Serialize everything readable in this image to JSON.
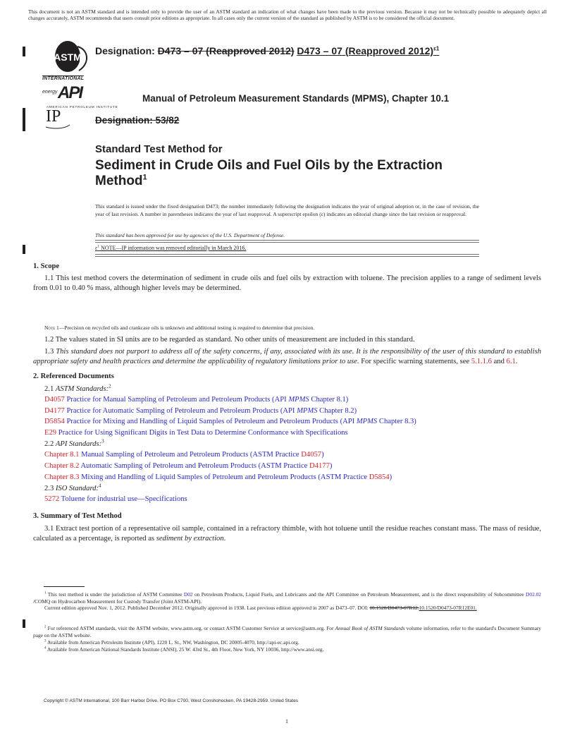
{
  "disclaimer": "This document is not an ASTM standard and is intended only to provide the user of an ASTM standard an indication of what changes have been made to the previous version. Because it may not be technically possible to adequately depict all changes accurately, ASTM recommends that users consult prior editions as appropriate. In all cases only the current version of the standard as published by ASTM is to be considered the official document.",
  "logos": {
    "astm_label": "INTERNATIONAL",
    "api_energy": "energy",
    "api_mark": "API",
    "api_label": "AMERICAN PETROLEUM INSTITUTE",
    "ip_mark": "IP"
  },
  "header": {
    "designation_label": "Designation: ",
    "designation_old": "D473 – 07 (Reapproved 2012)",
    "designation_new": "D473 – 07 (Reapproved 2012)",
    "designation_sup": "ε1",
    "mpms": "Manual of Petroleum Measurement Standards (MPMS), Chapter 10.1",
    "ip_designation_old": "Designation: 53/82"
  },
  "title": {
    "line1": "Standard Test Method for",
    "line2": "Sediment in Crude Oils and Fuel Oils by the Extraction Method",
    "sup": "1"
  },
  "issued_note": "This standard is issued under the fixed designation D473; the number immediately following the designation indicates the year of original adoption or, in the case of revision, the year of last revision. A number in parentheses indicates the year of last reapproval. A superscript epsilon (ε) indicates an editorial change since the last revision or reapproval.",
  "dod_note": "This standard has been approved for use by agencies of the U.S. Department of Defense.",
  "epsilon_note": {
    "sym": "ε",
    "sup": "1",
    "text": " NOTE—IP information was removed editorially in March 2016."
  },
  "section1": {
    "heading": "1. Scope",
    "p1_1": "1.1 This test method covers the determination of sediment in crude oils and fuel oils by extraction with toluene. The precision applies to a range of sediment levels from 0.01 to 0.40 % mass, although higher levels may be determined.",
    "note_label": "Note",
    "note_text": " 1—Precision on recycled oils and crankcase oils is unknown and additional testing is required to determine that precision.",
    "p1_2": "1.2 The values stated in SI units are to be regarded as standard. No other units of measurement are included in this standard.",
    "p1_3_num": "1.3 ",
    "p1_3_italic": "This standard does not purport to address all of the safety concerns, if any, associated with its use. It is the responsibility of the user of this standard to establish appropriate safety and health practices and determine the applicability of regulatory limitations prior to use.",
    "p1_3_tail": " For specific warning statements, see ",
    "link_a": "5.1.1.6",
    "and": " and ",
    "link_b": "6.1",
    "end": "."
  },
  "section2": {
    "heading": "2. Referenced Documents",
    "astm_num": "2.1 ",
    "astm_label": "ASTM Standards:",
    "astm_sup": "2",
    "astm_refs": [
      {
        "code": "D4057",
        "pre": " Practice for Manual Sampling of Petroleum and Petroleum Products (API ",
        "it": "MPMS",
        "post": " Chapter 8.1)"
      },
      {
        "code": "D4177",
        "pre": " Practice for Automatic Sampling of Petroleum and Petroleum Products (API ",
        "it": "MPMS",
        "post": " Chapter 8.2)"
      },
      {
        "code": "D5854",
        "pre": " Practice for Mixing and Handling of Liquid Samples of Petroleum and Petroleum Products (API ",
        "it": "MPMS",
        "post": " Chapter 8.3)"
      },
      {
        "code": "E29",
        "pre": " Practice for Using Significant Digits in Test Data to Determine Conformance with Specifications",
        "it": "",
        "post": ""
      }
    ],
    "api_num": "2.2 ",
    "api_label": "API Standards:",
    "api_sup": "3",
    "api_refs": [
      {
        "code": "Chapter 8.1",
        "text": " Manual Sampling of Petroleum and Petroleum Products (ASTM Practice ",
        "link": "D4057",
        "end": ")"
      },
      {
        "code": "Chapter 8.2",
        "text": " Automatic Sampling of Petroleum and Petroleum Products (ASTM Practice ",
        "link": "D4177",
        "end": ")"
      },
      {
        "code": "Chapter 8.3",
        "text": " Mixing and Handling of Liquid Samples of Petroleum and Petroleum Products (ASTM Practice ",
        "link": "D5854",
        "end": ")"
      }
    ],
    "iso_num": "2.3 ",
    "iso_label": "ISO Standard:",
    "iso_sup": "4",
    "iso_refs": [
      {
        "code": "5272",
        "text": "  Toluene for industrial use—Specifications"
      }
    ]
  },
  "section3": {
    "heading": "3. Summary of Test Method",
    "p3_1": "3.1 Extract test portion of a representative oil sample, contained in a refractory thimble, with hot toluene until the residue reaches constant mass. The mass of residue, calculated as a percentage, is reported as ",
    "p3_1_it": "sediment by extraction",
    "p3_1_end": "."
  },
  "footnotes": {
    "f1_sup": "1",
    "f1_a": " This test method is under the jurisdiction of ASTM Committee ",
    "f1_link1": "D02",
    "f1_b": " on Petroleum Products, Liquid Fuels, and Lubricants and the API Committee on Petroleum Measurement, and is the direct responsibility of Subcommittee ",
    "f1_link2": "D02.02",
    "f1_c": " /COMQ on Hydrocarbon Measurement for Custody Transfer (Joint ASTM-API).",
    "f1_current": "Current edition approved Nov. 1, 2012. Published December 2012. Originally approved in 1938. Last previous edition approved in 2007 as D473–07. DOI: ",
    "f1_doi_old": "10.1520/D0473-07R12.",
    "f1_doi_new": "10.1520/D0473-07R12E01.",
    "f2_sup": "2",
    "f2_a": " For referenced ASTM standards, visit the ASTM website, www.astm.org, or contact ASTM Customer Service at service@astm.org. For ",
    "f2_it": "Annual Book of ASTM Standards",
    "f2_b": " volume information, refer to the standard's Document Summary page on the ASTM website.",
    "f3_sup": "3",
    "f3": " Available from American Petroleum Institute (API), 1220 L. St., NW, Washington, DC 20005-4070, http://api-ec.api.org.",
    "f4_sup": "4",
    "f4": " Available from American National Standards Institute (ANSI), 25 W. 43rd St., 4th Floor, New York, NY 10036, http://www.ansi.org."
  },
  "footer": {
    "copyright": "Copyright © ASTM International, 100 Barr Harbor Drive, PO Box C700, West Conshohocken, PA 19428-2959. United States",
    "page_number": "1"
  },
  "colors": {
    "text": "#231f20",
    "link_code": "#d2232a",
    "link_title": "#2b2bbf"
  }
}
